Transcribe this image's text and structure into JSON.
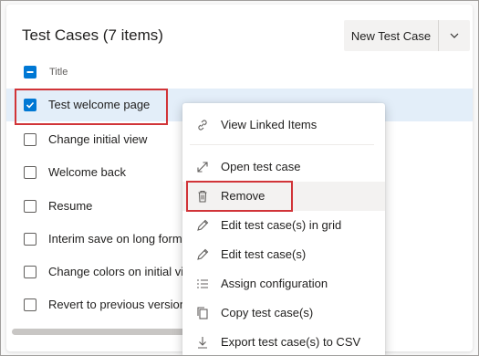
{
  "panel": {
    "title": "Test Cases (7 items)",
    "new_button_label": "New Test Case",
    "column_title": "Title"
  },
  "rows": [
    {
      "title": "Test welcome page",
      "checked": true
    },
    {
      "title": "Change initial view",
      "checked": false
    },
    {
      "title": "Welcome back",
      "checked": false
    },
    {
      "title": "Resume",
      "checked": false
    },
    {
      "title": "Interim save on long form",
      "checked": false
    },
    {
      "title": "Change colors on initial view",
      "checked": false
    },
    {
      "title": "Revert to previous version",
      "checked": false
    }
  ],
  "context_menu": {
    "items": [
      {
        "label": "View Linked Items",
        "icon": "link-icon"
      },
      {
        "label": "Open test case",
        "icon": "expand-arrows-icon"
      },
      {
        "label": "Remove",
        "icon": "trash-icon"
      },
      {
        "label": "Edit test case(s) in grid",
        "icon": "pencil-icon"
      },
      {
        "label": "Edit test case(s)",
        "icon": "pencil-icon"
      },
      {
        "label": "Assign configuration",
        "icon": "list-checklist-icon"
      },
      {
        "label": "Copy test case(s)",
        "icon": "copy-icon"
      },
      {
        "label": "Export test case(s) to CSV",
        "icon": "download-icon"
      }
    ]
  },
  "colors": {
    "accent": "#0078d4",
    "highlight": "#d13438",
    "selected_row": "#e3eef9"
  }
}
